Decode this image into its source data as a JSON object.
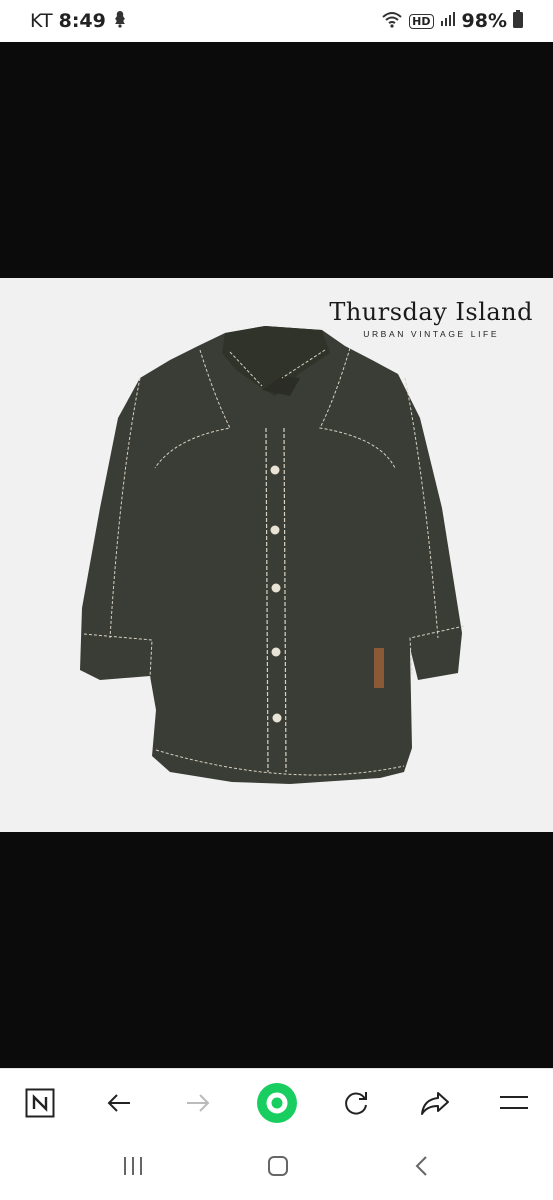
{
  "status_bar": {
    "carrier": "KT",
    "time": "8:49",
    "hd_badge": "HD",
    "battery": "98%"
  },
  "product_image": {
    "brand_name": "Thursday Island",
    "brand_tagline": "URBAN VINTAGE LIFE",
    "shirt_color": "#3a3d36",
    "stitch_color": "#d8d2c2",
    "background": "#f1f1f1"
  },
  "browser_toolbar": {
    "items": [
      "naver-home",
      "back",
      "forward",
      "green-dot",
      "reload",
      "share",
      "menu"
    ],
    "accent": "#19ce60"
  },
  "system_nav": {
    "items": [
      "recent-apps",
      "home",
      "back"
    ]
  }
}
